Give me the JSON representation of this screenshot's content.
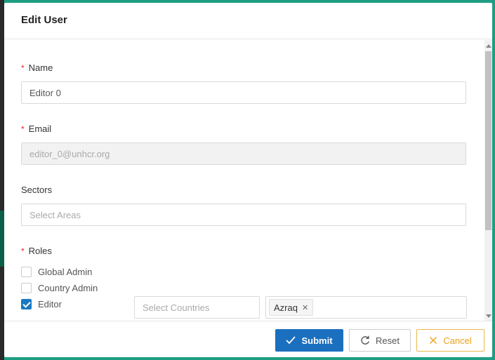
{
  "modal": {
    "title": "Edit User"
  },
  "form": {
    "name": {
      "label": "Name",
      "required_mark": "*",
      "value": "Editor 0"
    },
    "email": {
      "label": "Email",
      "required_mark": "*",
      "value": "editor_0@unhcr.org"
    },
    "sectors": {
      "label": "Sectors",
      "placeholder": "Select Areas"
    },
    "roles": {
      "label": "Roles",
      "required_mark": "*",
      "options": [
        {
          "label": "Global Admin",
          "checked": false
        },
        {
          "label": "Country Admin",
          "checked": false
        },
        {
          "label": "Editor",
          "checked": true
        }
      ],
      "countries_placeholder": "Select Countries",
      "selected_areas": [
        "Azraq"
      ]
    }
  },
  "footer": {
    "submit_label": "Submit",
    "reset_label": "Reset",
    "cancel_label": "Cancel"
  },
  "colors": {
    "primary": "#1a6fbf",
    "cancel": "#e9a21b",
    "required": "#ee2233",
    "backdrop_border": "#1d9e83"
  },
  "icons": {
    "submit": "check-icon",
    "reset": "reload-icon",
    "cancel": "close-icon"
  }
}
